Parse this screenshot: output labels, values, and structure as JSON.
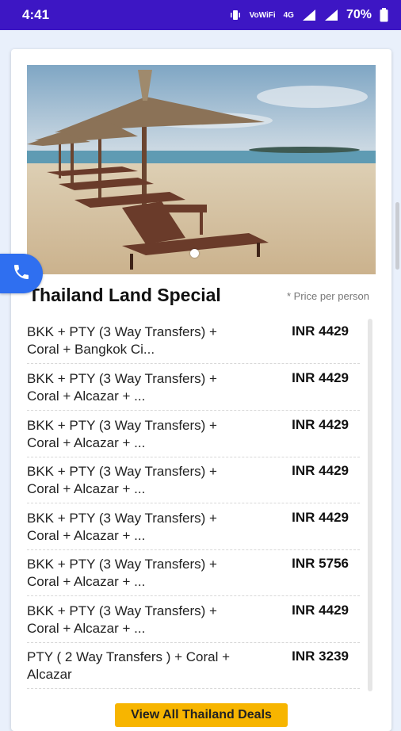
{
  "status_bar": {
    "time": "4:41",
    "vowifi_label": "VoWiFi",
    "network_label": "4G",
    "battery": "70%"
  },
  "package": {
    "title": "Thailand Land Special",
    "price_note": "* Price per person"
  },
  "deals": [
    {
      "desc": "BKK + PTY (3 Way Transfers) + Coral + Bangkok Ci...",
      "price": "INR 4429"
    },
    {
      "desc": "BKK + PTY (3 Way Transfers) + Coral + Alcazar + ...",
      "price": "INR 4429"
    },
    {
      "desc": "BKK + PTY (3 Way Transfers) + Coral + Alcazar + ...",
      "price": "INR 4429"
    },
    {
      "desc": "BKK + PTY (3 Way Transfers) + Coral + Alcazar + ...",
      "price": "INR 4429"
    },
    {
      "desc": "BKK + PTY (3 Way Transfers) + Coral + Alcazar + ...",
      "price": "INR 4429"
    },
    {
      "desc": "BKK + PTY (3 Way Transfers) + Coral + Alcazar + ...",
      "price": "INR 5756"
    },
    {
      "desc": "BKK + PTY (3 Way Transfers) + Coral + Alcazar + ...",
      "price": "INR 4429"
    },
    {
      "desc": "PTY ( 2 Way Transfers ) + Coral + Alcazar",
      "price": "INR 3239"
    }
  ],
  "view_all_label": "View All Thailand Deals",
  "icons": {
    "call": "phone-icon",
    "vibrate": "vibrate-icon",
    "signal": "signal-icon",
    "battery": "battery-icon"
  },
  "colors": {
    "status_bar": "#3d16c4",
    "call_button": "#2f6ff0",
    "view_all_button": "#f7b500"
  }
}
